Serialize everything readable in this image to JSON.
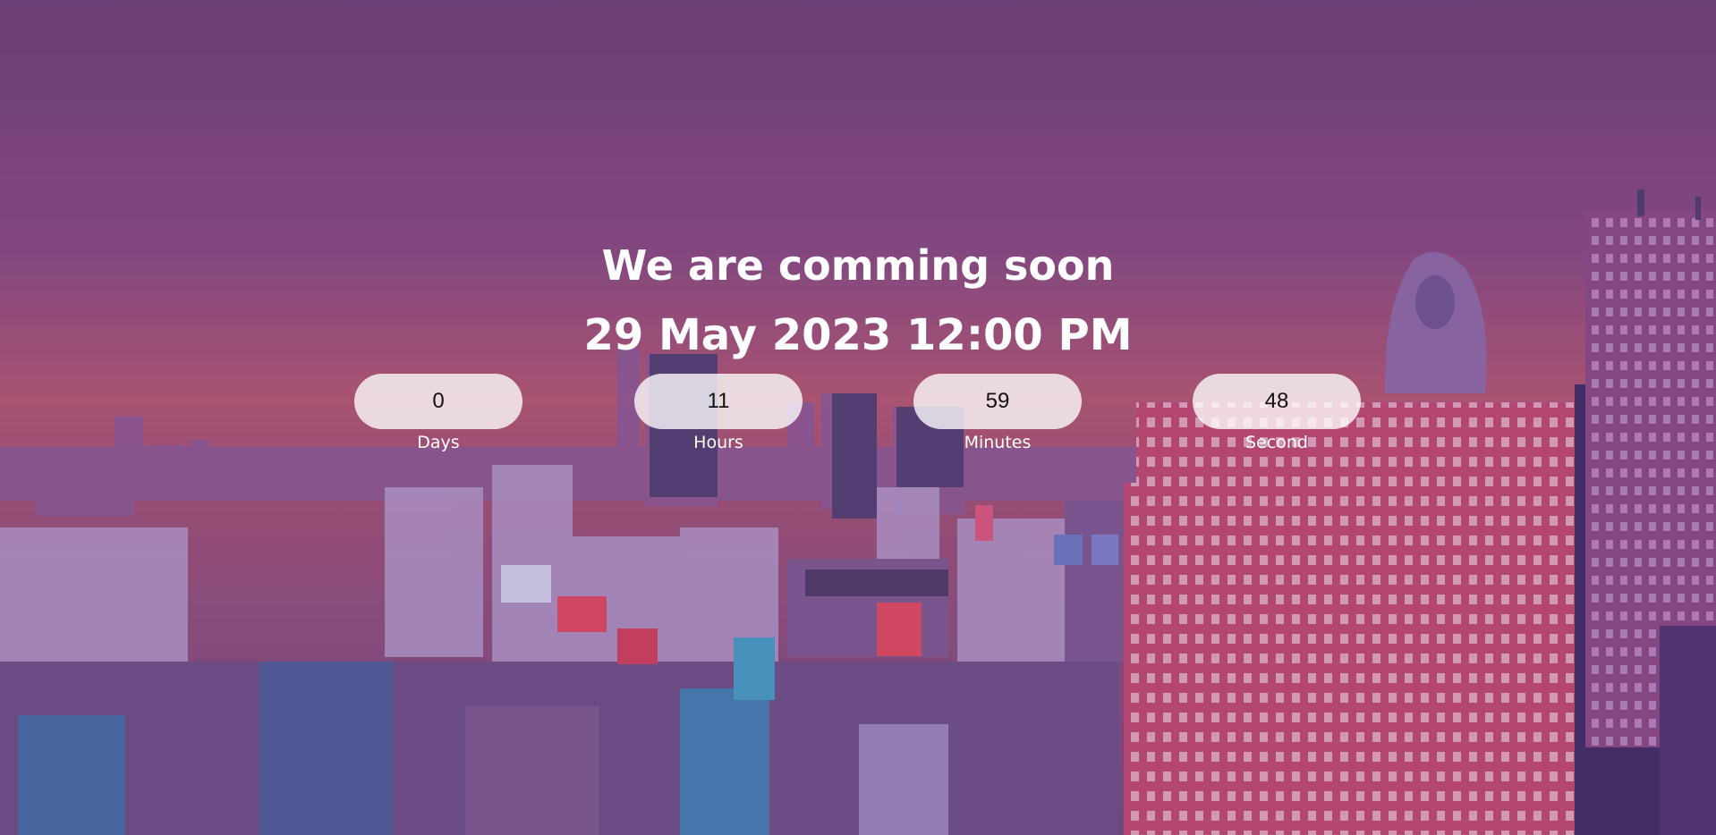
{
  "page": {
    "headline": "We are comming soon",
    "launch_date": "29 May 2023 12:00 PM"
  },
  "countdown": {
    "days": {
      "value": "0",
      "label": "Days"
    },
    "hours": {
      "value": "11",
      "label": "Hours"
    },
    "minutes": {
      "value": "59",
      "label": "Minutes"
    },
    "seconds": {
      "value": "48",
      "label": "Second"
    }
  },
  "theme": {
    "overlay_color": "#6e3c82",
    "text_color": "#ffffff",
    "pill_color": "#ffffff"
  }
}
